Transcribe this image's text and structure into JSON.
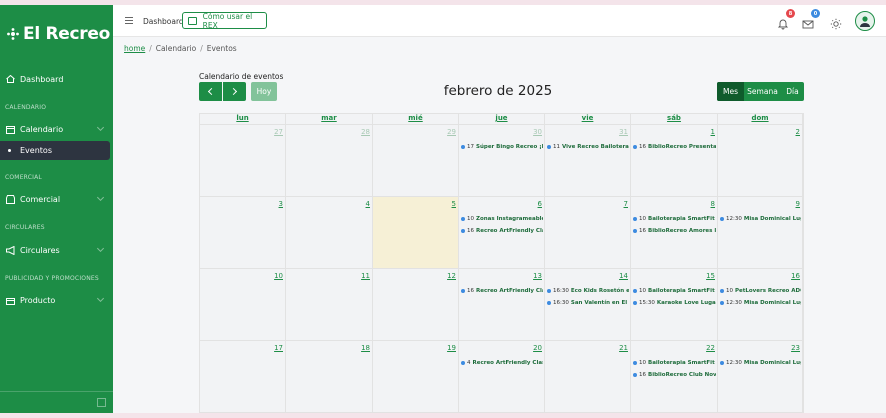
{
  "brand": {
    "name": "El Recreo"
  },
  "sidebar": {
    "dashboard": "Dashboard",
    "sections": [
      "CALENDARIO",
      "COMERCIAL",
      "CIRCULARES",
      "PUBLICIDAD Y PROMOCIONES"
    ],
    "calendario": "Calendario",
    "eventos": "Eventos",
    "comercial": "Comercial",
    "circulares": "Circulares",
    "producto": "Producto"
  },
  "topbar": {
    "dashboard": "Dashboard",
    "rex_button": "Cómo usar el REX",
    "notifications_count": "8",
    "messages_count": "0"
  },
  "breadcrumb": {
    "home": "home",
    "section": "Calendario",
    "page": "Eventos"
  },
  "calendar": {
    "caption": "Calendario de eventos",
    "today_label": "Hoy",
    "month_title": "febrero de 2025",
    "views": [
      "Mes",
      "Semana",
      "Día"
    ],
    "active_view": "Mes",
    "weekdays": [
      "lun",
      "mar",
      "mié",
      "jue",
      "vie",
      "sáb",
      "dom"
    ],
    "weeks": [
      [
        {
          "day": "27",
          "other": true,
          "events": []
        },
        {
          "day": "28",
          "other": true,
          "events": []
        },
        {
          "day": "29",
          "other": true,
          "events": []
        },
        {
          "day": "30",
          "other": true,
          "events": [
            {
              "time": "17",
              "title": "Súper Bingo Recreo ¡Ei"
            }
          ]
        },
        {
          "day": "31",
          "other": true,
          "events": [
            {
              "time": "11",
              "title": "Vive Recreo Bailoterap"
            }
          ]
        },
        {
          "day": "1",
          "other": false,
          "events": [
            {
              "time": "16",
              "title": "BiblioRecreo Presentac"
            }
          ]
        },
        {
          "day": "2",
          "other": false,
          "events": []
        }
      ],
      [
        {
          "day": "3",
          "other": false,
          "events": []
        },
        {
          "day": "4",
          "other": false,
          "events": []
        },
        {
          "day": "5",
          "other": false,
          "today": true,
          "events": []
        },
        {
          "day": "6",
          "other": false,
          "events": [
            {
              "time": "10",
              "title": "Zonas Instagrameables"
            },
            {
              "time": "16",
              "title": "Recreo ArtFriendly Cla"
            }
          ]
        },
        {
          "day": "7",
          "other": false,
          "events": []
        },
        {
          "day": "8",
          "other": false,
          "events": [
            {
              "time": "10",
              "title": "Bailoterapia SmartFit L"
            },
            {
              "time": "16",
              "title": "BiblioRecreo Amores li"
            }
          ]
        },
        {
          "day": "9",
          "other": false,
          "events": [
            {
              "time": "12:30",
              "title": "Misa Dominical Luga"
            }
          ]
        }
      ],
      [
        {
          "day": "10",
          "other": false,
          "events": []
        },
        {
          "day": "11",
          "other": false,
          "events": []
        },
        {
          "day": "12",
          "other": false,
          "events": []
        },
        {
          "day": "13",
          "other": false,
          "events": [
            {
              "time": "16",
              "title": "Recreo ArtFriendly Cla"
            }
          ]
        },
        {
          "day": "14",
          "other": false,
          "events": [
            {
              "time": "16:30",
              "title": "Eco Kids Rosetón en"
            },
            {
              "time": "16:30",
              "title": "San Valentín en El R"
            }
          ]
        },
        {
          "day": "15",
          "other": false,
          "events": [
            {
              "time": "10",
              "title": "Bailoterapia SmartFit L"
            },
            {
              "time": "15:30",
              "title": "Karaoke Love Lugar"
            }
          ]
        },
        {
          "day": "16",
          "other": false,
          "events": [
            {
              "time": "10",
              "title": "PetLovers Recreo ADO"
            },
            {
              "time": "12:30",
              "title": "Misa Dominical Luga"
            }
          ]
        }
      ],
      [
        {
          "day": "17",
          "other": false,
          "events": []
        },
        {
          "day": "18",
          "other": false,
          "events": []
        },
        {
          "day": "19",
          "other": false,
          "events": []
        },
        {
          "day": "20",
          "other": false,
          "events": [
            {
              "time": "4",
              "title": "Recreo ArtFriendly Clas"
            }
          ]
        },
        {
          "day": "21",
          "other": false,
          "events": []
        },
        {
          "day": "22",
          "other": false,
          "events": [
            {
              "time": "10",
              "title": "Bailoterapia SmartFit L"
            },
            {
              "time": "16",
              "title": "BiblioRecreo Club Nov"
            }
          ]
        },
        {
          "day": "23",
          "other": false,
          "events": [
            {
              "time": "12:30",
              "title": "Misa Dominical Luga"
            }
          ]
        }
      ]
    ]
  },
  "colors": {
    "brand_green": "#1d8d46",
    "active_dark": "#2d3440",
    "today_bg": "#f6f0d6",
    "event_dot": "#3d8be0",
    "badge_red": "#e5484d",
    "badge_blue": "#3d8be0"
  },
  "icons": {
    "dashboard": "home-icon",
    "calendario": "calendar-icon",
    "comercial": "store-icon",
    "circulares": "megaphone-icon",
    "producto": "box-icon"
  }
}
